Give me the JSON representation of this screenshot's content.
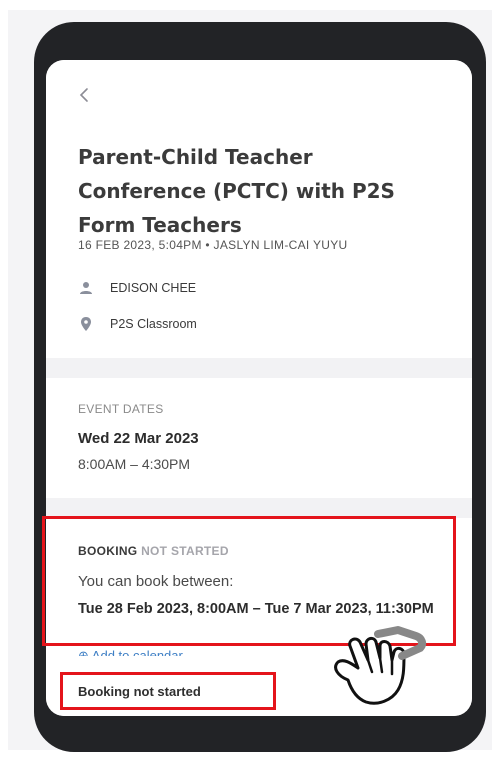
{
  "event": {
    "title": "Parent-Child Teacher Conference (PCTC) with P2S Form Teachers",
    "meta": "16 FEB 2023, 5:04PM  •  JASLYN LIM-CAI YUYU",
    "person": "EDISON CHEE",
    "location": "P2S Classroom",
    "icons": {
      "back": "chevron-left-icon",
      "person": "person-icon",
      "location": "location-pin-icon"
    }
  },
  "dates": {
    "label": "EVENT DATES",
    "date": "Wed 22 Mar 2023",
    "time": "8:00AM – 4:30PM"
  },
  "booking": {
    "label_strong": "BOOKING",
    "label_status": "NOT STARTED",
    "intro": "You can book between:",
    "range": "Tue 28 Feb 2023, 8:00AM – Tue 7 Mar 2023, 11:30PM",
    "add_to_calendar": "⊕ Add to calendar",
    "status": "Booking not started"
  },
  "colors": {
    "highlight": "#e4141b",
    "link": "#3e7fc5",
    "phone_frame": "#222326"
  }
}
